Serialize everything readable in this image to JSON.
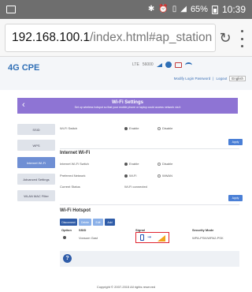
{
  "status_bar": {
    "battery": "65%",
    "time": "10:39"
  },
  "browser": {
    "url_host": "192.168.100.1",
    "url_path": "/index.html#ap_station"
  },
  "header": {
    "brand": "4G CPE",
    "network_type": "LTE",
    "operator": "56000",
    "links": {
      "modify_password": "Modify Login Password",
      "logout": "Logout",
      "language": "English"
    }
  },
  "banner": {
    "title": "Wi-Fi Settings",
    "subtitle": "Set up wireless hotspot so that your mobile phone or laptop could access network via it"
  },
  "sidebar": {
    "items": [
      {
        "label": "SSID",
        "active": false
      },
      {
        "label": "WPS",
        "active": false
      },
      {
        "label": "Internet Wi-Fi",
        "active": true
      },
      {
        "label": "Advanced Settings",
        "active": false
      },
      {
        "label": "WLAN MAC Filter",
        "active": false
      }
    ]
  },
  "wifi_switch": {
    "label": "Wi-Fi Switch",
    "option_enable": "Enable",
    "option_disable": "Disable",
    "selected": "Enable"
  },
  "apply_label": "Apply",
  "internet_wifi": {
    "title": "Internet Wi-Fi",
    "switch": {
      "label": "Internet Wi-Fi Switch",
      "option_enable": "Enable",
      "option_disable": "Disable",
      "selected": "Enable"
    },
    "preferred": {
      "label": "Preferred Network",
      "option_wifi": "Wi-Fi",
      "option_wwan": "WWAN",
      "selected": "Wi-Fi"
    },
    "status": {
      "label": "Current Status",
      "value": "Wi-Fi connected"
    }
  },
  "hotspot": {
    "title": "Wi-Fi Hotspot",
    "buttons": {
      "disconnect": "Disconnect",
      "delete": "Delete",
      "edit": "Edit",
      "add": "Add"
    },
    "columns": {
      "option": "Option",
      "ssid": "SSID",
      "signal": "Signal",
      "security": "Security Mode"
    },
    "rows": [
      {
        "ssid": "Vonsum Gast",
        "security": "WPA-PSK/WPA2-PSK"
      }
    ]
  },
  "info": {
    "icon_text": "?"
  },
  "footer": {
    "copyright": "Copyright © 2007-2015 All rights reserved"
  },
  "colors": {
    "banner": "#8e74d4",
    "accent": "#2f5ca8",
    "signal_highlight": "#e0242f",
    "signal_bars": "#f2a51a"
  },
  "icons": {
    "status_bar": [
      "bluetooth-icon",
      "alarm-icon",
      "vibrate-icon",
      "signal-icon",
      "battery-icon"
    ],
    "header": [
      "signal-strength-icon",
      "network-icon",
      "mail-icon",
      "wifi-icon"
    ],
    "hotspot_row": [
      "phone-icon",
      "arrow-icon",
      "signal-bars-icon"
    ]
  }
}
